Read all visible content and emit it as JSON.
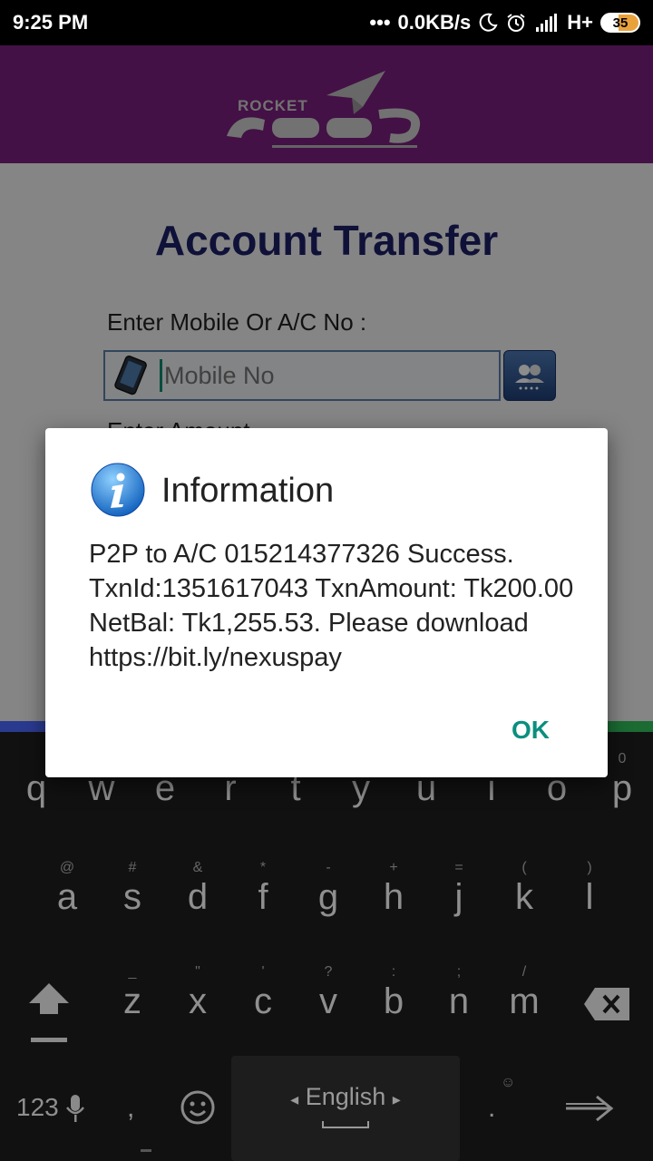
{
  "status_bar": {
    "time": "9:25 PM",
    "dots": "•••",
    "network_speed": "0.0KB/s",
    "network_type": "H+",
    "battery": "35"
  },
  "app": {
    "logo_text": "ROCKET",
    "title": "Account Transfer",
    "mobile_label": "Enter Mobile Or A/C No :",
    "mobile_placeholder": "Mobile No",
    "second_label": "Enter Amount"
  },
  "dialog": {
    "title": "Information",
    "message": "P2P to A/C 015214377326 Success. TxnId:1351617043 TxnAmount: Tk200.00 NetBal: Tk1,255.53. Please download https://bit.ly/nexuspay",
    "ok_label": "OK"
  },
  "keyboard": {
    "row1": [
      {
        "key": "q",
        "hint": ""
      },
      {
        "key": "w",
        "hint": ""
      },
      {
        "key": "e",
        "hint": ""
      },
      {
        "key": "r",
        "hint": ""
      },
      {
        "key": "t",
        "hint": ""
      },
      {
        "key": "y",
        "hint": ""
      },
      {
        "key": "u",
        "hint": ""
      },
      {
        "key": "i",
        "hint": ""
      },
      {
        "key": "o",
        "hint": ""
      },
      {
        "key": "p",
        "hint": "0"
      }
    ],
    "row2": [
      {
        "key": "a",
        "hint": "@"
      },
      {
        "key": "s",
        "hint": "#"
      },
      {
        "key": "d",
        "hint": "&"
      },
      {
        "key": "f",
        "hint": "*"
      },
      {
        "key": "g",
        "hint": "-"
      },
      {
        "key": "h",
        "hint": "+"
      },
      {
        "key": "j",
        "hint": "="
      },
      {
        "key": "k",
        "hint": "("
      },
      {
        "key": "l",
        "hint": ")"
      }
    ],
    "row3": [
      {
        "key": "z",
        "hint": "_"
      },
      {
        "key": "x",
        "hint": "\""
      },
      {
        "key": "c",
        "hint": "'"
      },
      {
        "key": "v",
        "hint": "?"
      },
      {
        "key": "b",
        "hint": ":"
      },
      {
        "key": "n",
        "hint": ";"
      },
      {
        "key": "m",
        "hint": "/"
      }
    ],
    "numbers_key": "123",
    "comma": ",",
    "period": ".",
    "language": "English",
    "lang_left": "◂",
    "lang_right": "▸"
  }
}
